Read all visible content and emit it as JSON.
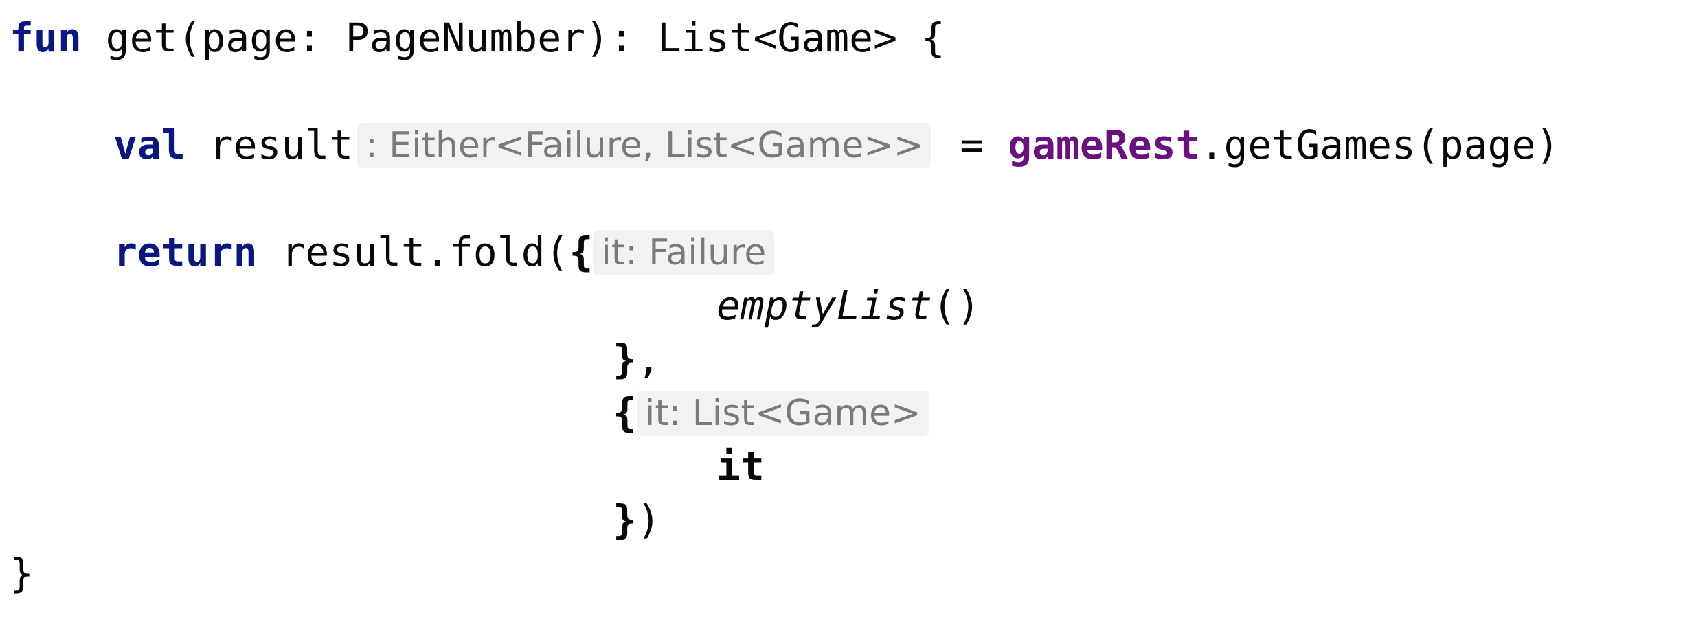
{
  "code": {
    "line1": {
      "keyword_fun": "fun",
      "signature": " get(page: PageNumber): List<Game> {"
    },
    "line2": {
      "keyword_val": "val",
      "name": " result",
      "type_hint": ": Either<Failure, List<Game>>",
      "assign": " = ",
      "receiver": "gameRest",
      "call": ".getGames(page)"
    },
    "line3": {
      "keyword_return": "return",
      "call": " result.fold(",
      "brace": "{",
      "param_hint": "it: Failure"
    },
    "line4": {
      "function": "emptyList",
      "parens": "()"
    },
    "line5": {
      "brace": "}",
      "comma": ","
    },
    "line6": {
      "brace": "{",
      "param_hint": "it: List<Game>"
    },
    "line7": {
      "it": "it"
    },
    "line8": {
      "brace": "}",
      "paren": ")"
    },
    "line9": {
      "brace": "}"
    }
  },
  "colors": {
    "keyword": "#0a1682",
    "property": "#6a117f",
    "hint_text": "#7a7a7a",
    "hint_background": "#f2f2f2"
  }
}
